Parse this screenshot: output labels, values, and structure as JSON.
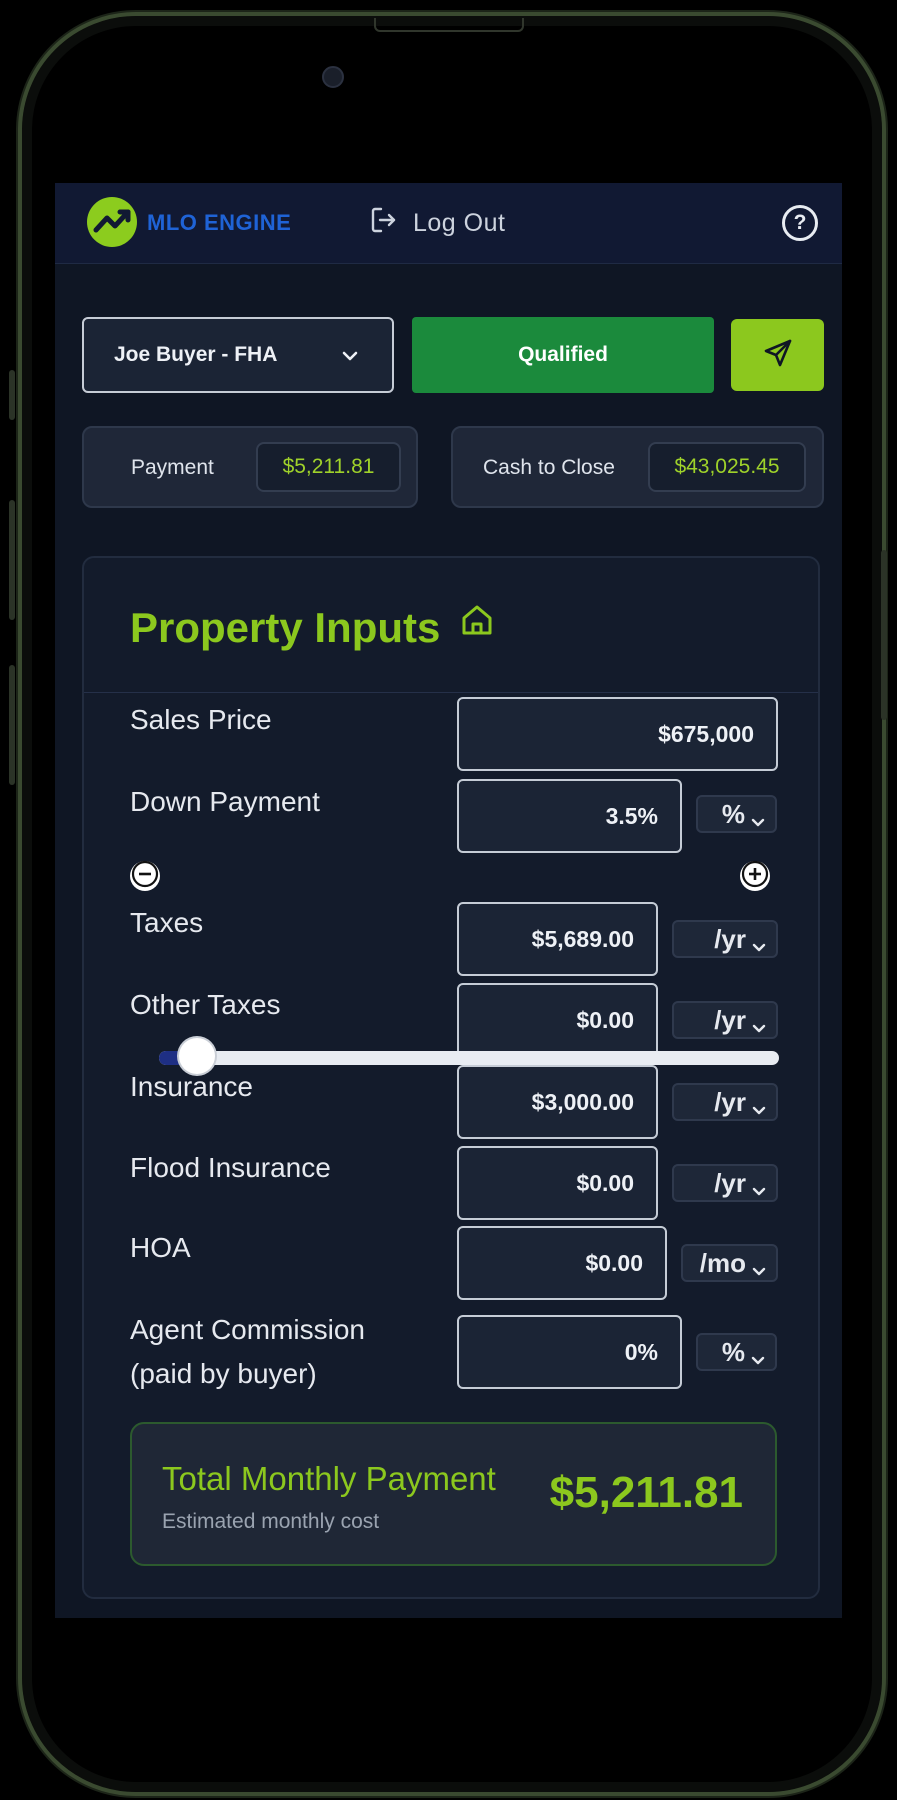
{
  "header": {
    "logo_text": "MLO ENGINE",
    "logout_label": "Log Out",
    "help_glyph": "?"
  },
  "controls": {
    "borrower": "Joe Buyer - FHA",
    "status": "Qualified"
  },
  "summary": {
    "payment_label": "Payment",
    "payment_value": "$5,211.81",
    "cash_label": "Cash to Close",
    "cash_value": "$43,025.45"
  },
  "property": {
    "title": "Property Inputs",
    "sales_price": {
      "label": "Sales Price",
      "value": "$675,000"
    },
    "down_payment": {
      "label": "Down Payment",
      "value": "3.5%",
      "unit": "%",
      "slider_level": 0.035
    },
    "taxes": {
      "label": "Taxes",
      "value": "$5,689.00",
      "unit": "/yr"
    },
    "other_taxes": {
      "label": "Other Taxes",
      "value": "$0.00",
      "unit": "/yr"
    },
    "insurance": {
      "label": "Insurance",
      "value": "$3,000.00",
      "unit": "/yr"
    },
    "flood_insurance": {
      "label": "Flood Insurance",
      "value": "$0.00",
      "unit": "/yr"
    },
    "hoa": {
      "label": "HOA",
      "value": "$0.00",
      "unit": "/mo"
    },
    "agent_commission": {
      "label_line1": "Agent Commission",
      "label_line2": "(paid by buyer)",
      "value": "0%",
      "unit": "%"
    }
  },
  "total": {
    "title": "Total Monthly Payment",
    "subtitle": "Estimated monthly cost",
    "amount": "$5,211.81"
  },
  "colors": {
    "accent_green": "#8cc81e",
    "qualified_green": "#1b8a3c",
    "logo_blue": "#1f63d6",
    "background": "#0f1624"
  },
  "icons": [
    "logo-icon",
    "logout-icon",
    "help-icon",
    "chevron-down-icon",
    "send-icon",
    "home-icon",
    "minus-icon",
    "plus-icon"
  ]
}
